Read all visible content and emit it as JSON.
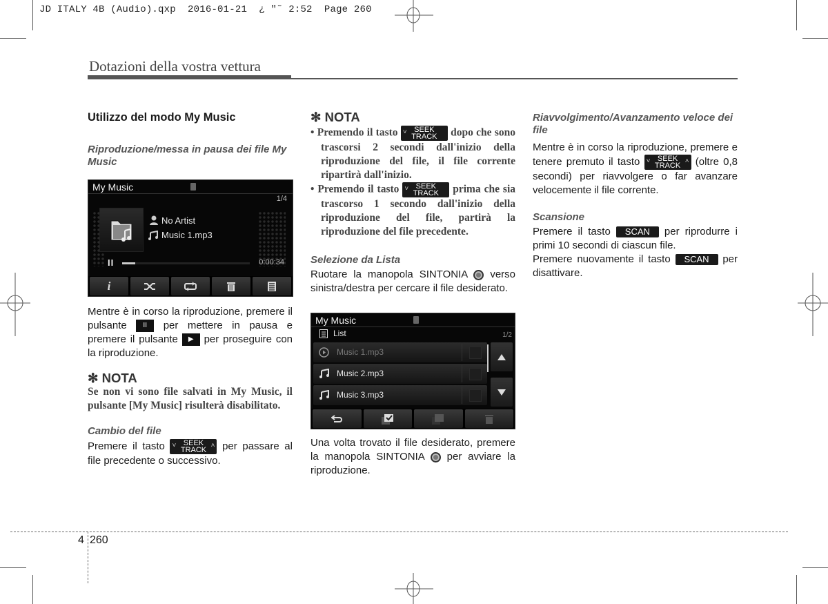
{
  "slug": {
    "text": "JD ITALY 4B (Audio).qxp  2016-01-21  ¿ \"˜ 2:52  Page 260"
  },
  "header": {
    "chapter_title": "Dotazioni della vostra vettura"
  },
  "col1": {
    "heading": "Utilizzo del modo My Music",
    "sub1": "Riproduzione/messa in pausa dei file My Music",
    "screen": {
      "title": "My Music",
      "track_count": "1/4",
      "artist": "No Artist",
      "track": "Music 1.mp3",
      "elapsed": "0:00:34",
      "progress_fraction": 0.1,
      "buttons": [
        "info-icon",
        "shuffle-icon",
        "repeat-icon",
        "delete-icon",
        "list-icon"
      ]
    },
    "para1_a": "Mentre è in corso la riproduzione, premere il pulsante",
    "para1_b": "per mettere in pausa e premere il pulsante",
    "para1_c": "per proseguire con la riproduzione.",
    "pause_glyph": "II",
    "play_glyph": "▶",
    "nota_heading": "✻ NOTA",
    "nota_text": "Se non vi sono file salvati in My Music, il pulsante [My Music] risulterà disabilitato.",
    "sub2": "Cambio del file",
    "para2_a": "Premere il tasto",
    "para2_b": "per passare al file precedente o successivo."
  },
  "keys": {
    "seek_top": "SEEK",
    "seek_bottom": "TRACK",
    "chev_down": "˅",
    "chev_up": "˄",
    "scan": "SCAN"
  },
  "col2": {
    "nota_heading": "✻ NOTA",
    "bullet1_a": "Premendo il tasto",
    "bullet1_b": "dopo che sono trascorsi 2 secondi dall'inizio della riproduzione del file, il file corrente ripartirà dall'inizio.",
    "bullet2_a": "Premendo il tasto",
    "bullet2_b": "prima che sia trascorso 1 secondo dall'inizio della riproduzione del file, partirà la riproduzione del file precedente.",
    "sub1": "Selezione da Lista",
    "para1_a": "Ruotare la manopola SINTONIA",
    "para1_b": "verso sinistra/destra per cercare il file desiderato.",
    "screen": {
      "title": "My Music",
      "list_label": "List",
      "page": "1/2",
      "items": [
        {
          "name": "Music 1.mp3",
          "icon": "play-circle-icon",
          "playing": true
        },
        {
          "name": "Music 2.mp3",
          "icon": "music-note-icon",
          "playing": false
        },
        {
          "name": "Music 3.mp3",
          "icon": "music-note-icon",
          "playing": false
        }
      ],
      "bottom_buttons": [
        "back-icon",
        "select-all-icon",
        "deselect-all-icon",
        "delete-icon"
      ]
    },
    "para2_a": "Una volta trovato il file desiderato, premere la manopola SINTONIA",
    "para2_b": "per avviare la riproduzione."
  },
  "col3": {
    "sub1": "Riavvolgimento/Avanzamento veloce dei file",
    "para1_a": "Mentre è in corso la riproduzione, premere e tenere premuto il tasto",
    "para1_b": "(oltre 0,8 secondi) per riavvolgere o far avanzare velocemente il file corrente.",
    "sub2": "Scansione",
    "para2_a": "Premere il tasto",
    "para2_b": "per riprodurre i primi 10 secondi di ciascun file.",
    "para3_a": "Premere nuovamente il tasto",
    "para3_b": "per disattivare."
  },
  "footer": {
    "chapter_num": "4",
    "page_num": "260"
  }
}
